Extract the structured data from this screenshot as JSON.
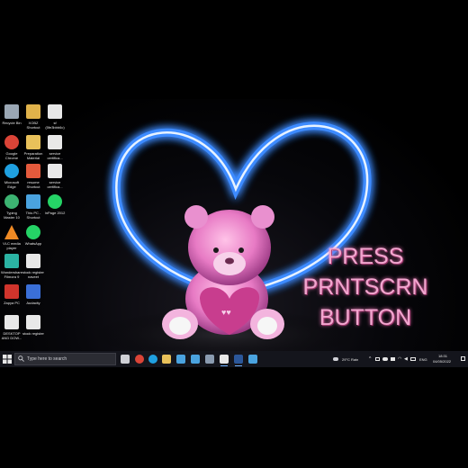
{
  "desktop": {
    "icons": [
      {
        "label": "Recycle Bin",
        "icon": "recycle-bin-icon",
        "color": "#9aa7b4"
      },
      {
        "label": "XOBZ\nShortcut",
        "icon": "shortcut-icon",
        "color": "#e0b24a"
      },
      {
        "label": "sf\n(5fe3bbb6c)",
        "icon": "document-icon",
        "color": "#e8e8e8"
      },
      {
        "label": "Google\nChrome",
        "icon": "chrome-icon",
        "color": "#db4437"
      },
      {
        "label": "Preparation\nMaterial",
        "icon": "folder-icon",
        "color": "#e8c15a"
      },
      {
        "label": "service\ncertifica...",
        "icon": "document-icon",
        "color": "#e8e8e8"
      },
      {
        "label": "Microsoft\nEdge",
        "icon": "edge-icon",
        "color": "#1fa0e0"
      },
      {
        "label": "resume\nShortcut",
        "icon": "pdf-icon",
        "color": "#e45a3c"
      },
      {
        "label": "service\ncertifica...",
        "icon": "document-icon",
        "color": "#e8e8e8"
      },
      {
        "label": "Typing\nMaster 10",
        "icon": "typing-master-icon",
        "color": "#3cb371"
      },
      {
        "label": "This PC -\nShortcut",
        "icon": "this-pc-icon",
        "color": "#4aa3df"
      },
      {
        "label": "InPage 2012",
        "icon": "whatsapp-icon",
        "color": "#25d366"
      },
      {
        "label": "VLC media\nplayer",
        "icon": "vlc-icon",
        "color": "#f08a24"
      },
      {
        "label": "WhatsApp",
        "icon": "whatsapp-icon",
        "color": "#25d366"
      },
      {
        "label": "Wondershare\nFilmora 9",
        "icon": "filmora-icon",
        "color": "#2bb3a3"
      },
      {
        "label": "stock register\nnaveet",
        "icon": "document-icon",
        "color": "#e8e8e8"
      },
      {
        "label": "Zapya PC",
        "icon": "zapya-icon",
        "color": "#d0342c"
      },
      {
        "label": "Audacity",
        "icon": "audacity-icon",
        "color": "#3a6fd8"
      },
      {
        "label": "DESKTOP\nAND DOW...",
        "icon": "document-icon",
        "color": "#e8e8e8"
      },
      {
        "label": "stock register",
        "icon": "document-icon",
        "color": "#e8e8e8"
      }
    ]
  },
  "overlay": {
    "line1": "PRESS",
    "line2": "PRNTSCRN",
    "line3": "BUTTON"
  },
  "taskbar": {
    "search_placeholder": "Type here to search",
    "apps": [
      {
        "icon": "task-view-icon",
        "color": "#cfd0d6"
      },
      {
        "icon": "chrome-icon",
        "color": "#db4437"
      },
      {
        "icon": "edge-icon",
        "color": "#1fa0e0"
      },
      {
        "icon": "file-explorer-icon",
        "color": "#e8c15a"
      },
      {
        "icon": "store-icon",
        "color": "#4aa3df"
      },
      {
        "icon": "mail-icon",
        "color": "#4aa3df"
      },
      {
        "icon": "photos-icon",
        "color": "#8a9bb0"
      },
      {
        "icon": "download-icon",
        "color": "#e8e8e8"
      },
      {
        "icon": "word-icon",
        "color": "#2b579a"
      },
      {
        "icon": "app-icon",
        "color": "#4aa3df"
      }
    ],
    "weather": "29°C  Rain",
    "language": "ENG",
    "time": "18:31",
    "date": "04/05/2022"
  },
  "colors": {
    "heart_glow": "#2f7bff",
    "overlay_text": "#f2a6cf",
    "taskbar_bg": "#14151c"
  }
}
